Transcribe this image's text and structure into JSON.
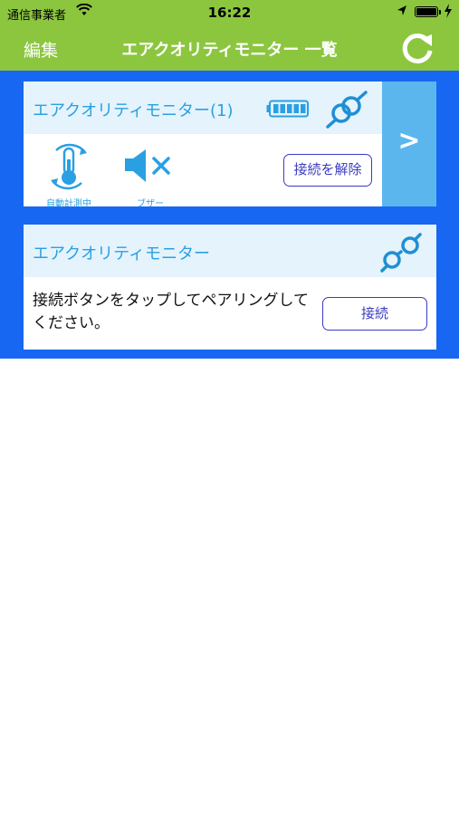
{
  "status_bar": {
    "carrier": "通信事業者",
    "time": "16:22"
  },
  "nav": {
    "edit_label": "編集",
    "title": "エアクオリティモニター 一覧",
    "refresh_icon": "refresh-icon"
  },
  "devices": [
    {
      "name": "エアクオリティモニター(1)",
      "connected": true,
      "battery_icon": "battery-full-icon",
      "status_icon": "link-connected-icon",
      "auto_measure_label": "自動計測中",
      "buzzer_label": "ブザー",
      "disconnect_label": "接続を解除",
      "detail_label": ">"
    },
    {
      "name": "エアクオリティモニター",
      "connected": false,
      "status_icon": "link-broken-icon",
      "instruction": "接続ボタンをタップしてペアリングしてください。",
      "connect_label": "接続"
    }
  ],
  "colors": {
    "nav_green": "#8cc63f",
    "background_blue": "#1767f2",
    "header_light_blue": "#e4f3fc",
    "accent_cyan": "#2aa0e2",
    "detail_blue": "#5bb6ee",
    "button_border": "#3b3cc0"
  }
}
